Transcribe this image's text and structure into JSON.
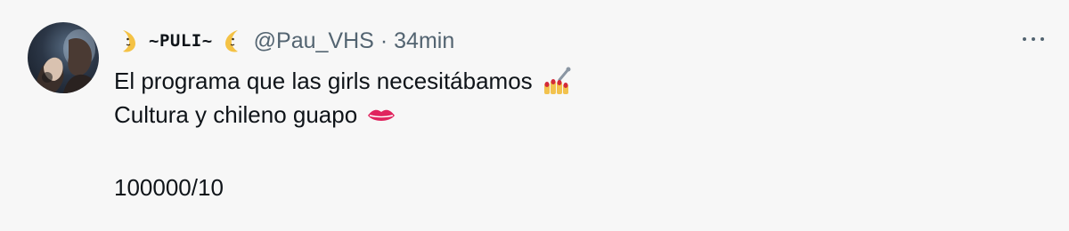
{
  "tweet": {
    "display_name": "~PULI~",
    "handle": "@Pau_VHS",
    "separator": "·",
    "time": "34min",
    "text_lines": [
      "El programa que las girls necesitábamos",
      "Cultura y chileno guapo",
      "100000/10"
    ],
    "icons": {
      "name_left": "crescent-moon-face-icon",
      "name_right": "crescent-moon-face-icon",
      "line1_emoji": "nail-polish-icon",
      "line2_emoji": "lips-icon",
      "more": "more-options-icon",
      "avatar": "user-avatar"
    },
    "colors": {
      "background": "#f7f7f7",
      "text_primary": "#0f1419",
      "text_secondary": "#536471",
      "moon": "#f4c245",
      "lips": "#e0245e"
    }
  }
}
